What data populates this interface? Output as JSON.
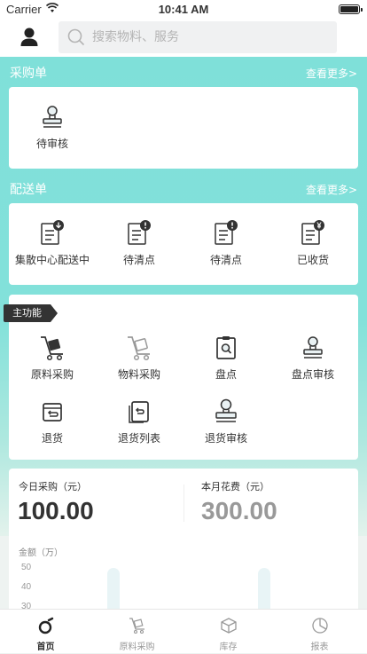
{
  "status_bar": {
    "carrier": "Carrier",
    "time": "10:41 AM"
  },
  "search": {
    "placeholder": "搜索物料、服务"
  },
  "purchase": {
    "title": "采购单",
    "more": "查看更多>",
    "items": [
      {
        "label": "待审核",
        "icon": "stamp-icon"
      }
    ]
  },
  "delivery": {
    "title": "配送单",
    "more": "查看更多>",
    "items": [
      {
        "label": "集散中心配送中",
        "icon": "doc-download-icon"
      },
      {
        "label": "待清点",
        "icon": "doc-alert-icon"
      },
      {
        "label": "待清点",
        "icon": "doc-alert-icon"
      },
      {
        "label": "已收货",
        "icon": "doc-yen-icon"
      }
    ]
  },
  "main_functions": {
    "tag": "主功能",
    "items": [
      {
        "label": "原料采购",
        "icon": "hand-truck-icon"
      },
      {
        "label": "物料采购",
        "icon": "cart-icon"
      },
      {
        "label": "盘点",
        "icon": "inventory-check-icon"
      },
      {
        "label": "盘点审核",
        "icon": "stamp-icon"
      },
      {
        "label": "退货",
        "icon": "return-icon"
      },
      {
        "label": "退货列表",
        "icon": "return-list-icon"
      },
      {
        "label": "退货审核",
        "icon": "stamp-icon"
      }
    ]
  },
  "stats": {
    "today_label": "今日采购（元）",
    "today_value": "100.00",
    "month_label": "本月花费（元）",
    "month_value": "300.00",
    "chart_unit": "金额（万）",
    "ticks": [
      "50",
      "40",
      "30"
    ]
  },
  "tabs": [
    {
      "label": "首页",
      "icon": "home-icon",
      "active": true
    },
    {
      "label": "原料采购",
      "icon": "cart-icon",
      "active": false
    },
    {
      "label": "库存",
      "icon": "box-icon",
      "active": false
    },
    {
      "label": "报表",
      "icon": "pie-chart-icon",
      "active": false
    }
  ],
  "colors": {
    "accent": "#7fe0d9",
    "dark": "#333333",
    "muted": "#999999"
  }
}
